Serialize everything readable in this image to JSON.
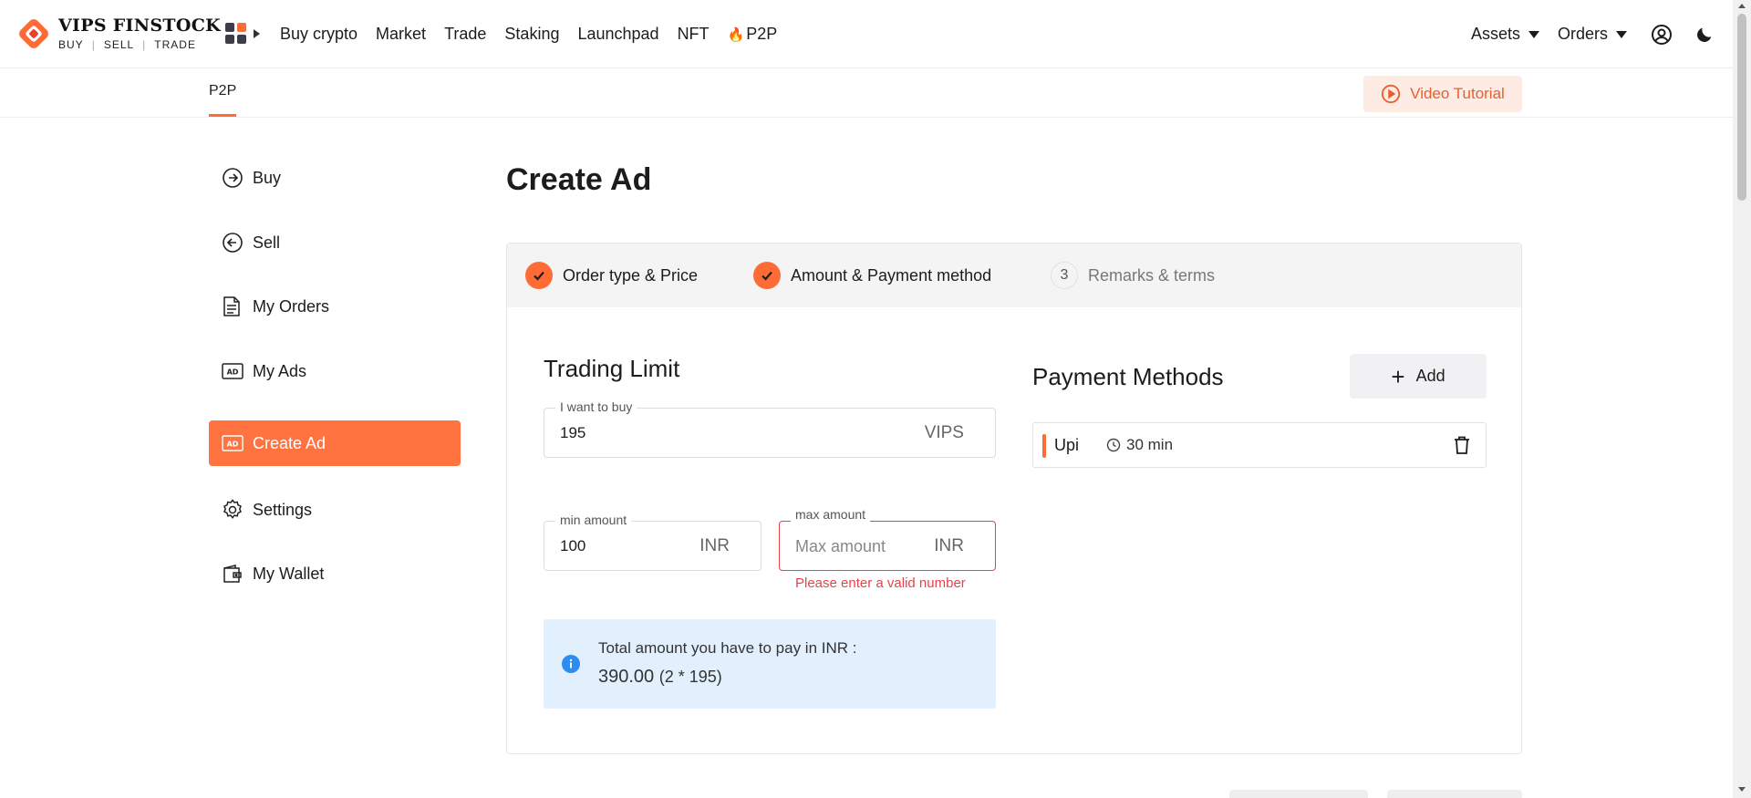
{
  "brand": {
    "name": "VIPS FINSTOCK",
    "tag1": "BUY",
    "tag2": "SELL",
    "tag3": "TRADE",
    "accent": "#ff6b35"
  },
  "nav": {
    "items": [
      {
        "label": "Buy crypto"
      },
      {
        "label": "Market"
      },
      {
        "label": "Trade"
      },
      {
        "label": "Staking"
      },
      {
        "label": "Launchpad"
      },
      {
        "label": "NFT"
      },
      {
        "label": "P2P",
        "icon": "fire-icon"
      }
    ],
    "assets": "Assets",
    "orders": "Orders"
  },
  "subnav": {
    "tab": "P2P",
    "video_tutorial": "Video Tutorial"
  },
  "sidebar": {
    "items": [
      {
        "label": "Buy",
        "icon": "arrow-right-circle-icon"
      },
      {
        "label": "Sell",
        "icon": "arrow-left-circle-icon"
      },
      {
        "label": "My Orders",
        "icon": "document-icon"
      },
      {
        "label": "My Ads",
        "icon": "ad-icon"
      },
      {
        "label": "Create Ad",
        "icon": "ad-icon",
        "active": true
      },
      {
        "label": "Settings",
        "icon": "gear-icon"
      },
      {
        "label": "My Wallet",
        "icon": "wallet-icon"
      }
    ]
  },
  "main": {
    "title": "Create Ad",
    "steps": [
      {
        "label": "Order type & Price",
        "status": "done"
      },
      {
        "label": "Amount & Payment method",
        "status": "done"
      },
      {
        "number": "3",
        "label": "Remarks & terms",
        "status": "pending"
      }
    ],
    "trading_limit": {
      "title": "Trading Limit",
      "want_to_buy": {
        "label": "I want to buy",
        "value": "195",
        "unit": "VIPS"
      },
      "min_amount": {
        "label": "min amount",
        "value": "100",
        "unit": "INR"
      },
      "max_amount": {
        "label": "max amount",
        "placeholder": "Max amount",
        "unit": "INR",
        "error": "Please enter a valid number"
      },
      "total": {
        "label": "Total amount you have to pay in INR :",
        "value": "390.00",
        "formula": "(2 * 195)"
      }
    },
    "payment_methods": {
      "title": "Payment Methods",
      "add_label": "Add",
      "items": [
        {
          "name": "Upi",
          "time": "30 min"
        }
      ]
    }
  }
}
